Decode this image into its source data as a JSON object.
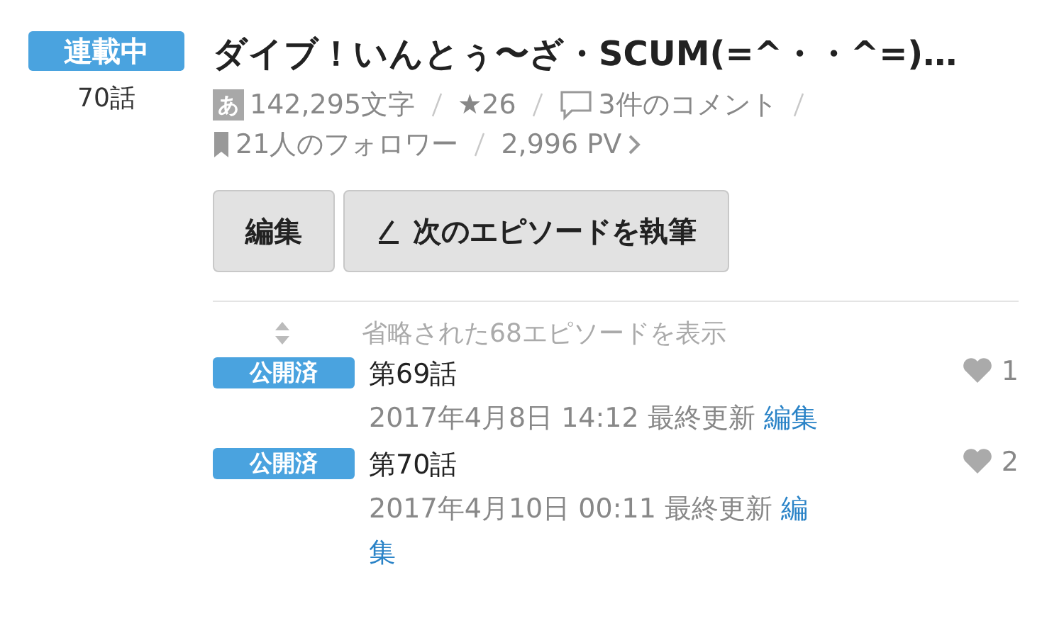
{
  "work": {
    "status": "連載中",
    "episode_count": "70話",
    "title": "ダイブ！いんとぅ〜ざ・SCUM(=^・・^=)…",
    "stats": [
      {
        "kind": "chars",
        "text": "142,295文字",
        "icon": "あ"
      },
      {
        "kind": "stars",
        "text": "★26"
      },
      {
        "kind": "comments",
        "text": "3件のコメント"
      },
      {
        "kind": "followers",
        "text": "21人のフォロワー"
      },
      {
        "kind": "pv",
        "text": "2,996 PV"
      }
    ]
  },
  "buttons": [
    {
      "kind": "plain",
      "label": "編集"
    },
    {
      "kind": "pen",
      "label": "次のエピソードを執筆"
    }
  ],
  "omitted": "省略された68エピソードを表示",
  "episodes": [
    {
      "status": "公開済",
      "title": "第69話",
      "updated": "2017年4月8日 14:12 最終更新",
      "edit": "編",
      "edit_rest": "集",
      "likes": "1"
    },
    {
      "status": "公開済",
      "title": "第70話",
      "updated": "2017年4月10日 00:11 最終更新",
      "edit": "編",
      "edit_rest": "集",
      "likes": "2"
    }
  ]
}
